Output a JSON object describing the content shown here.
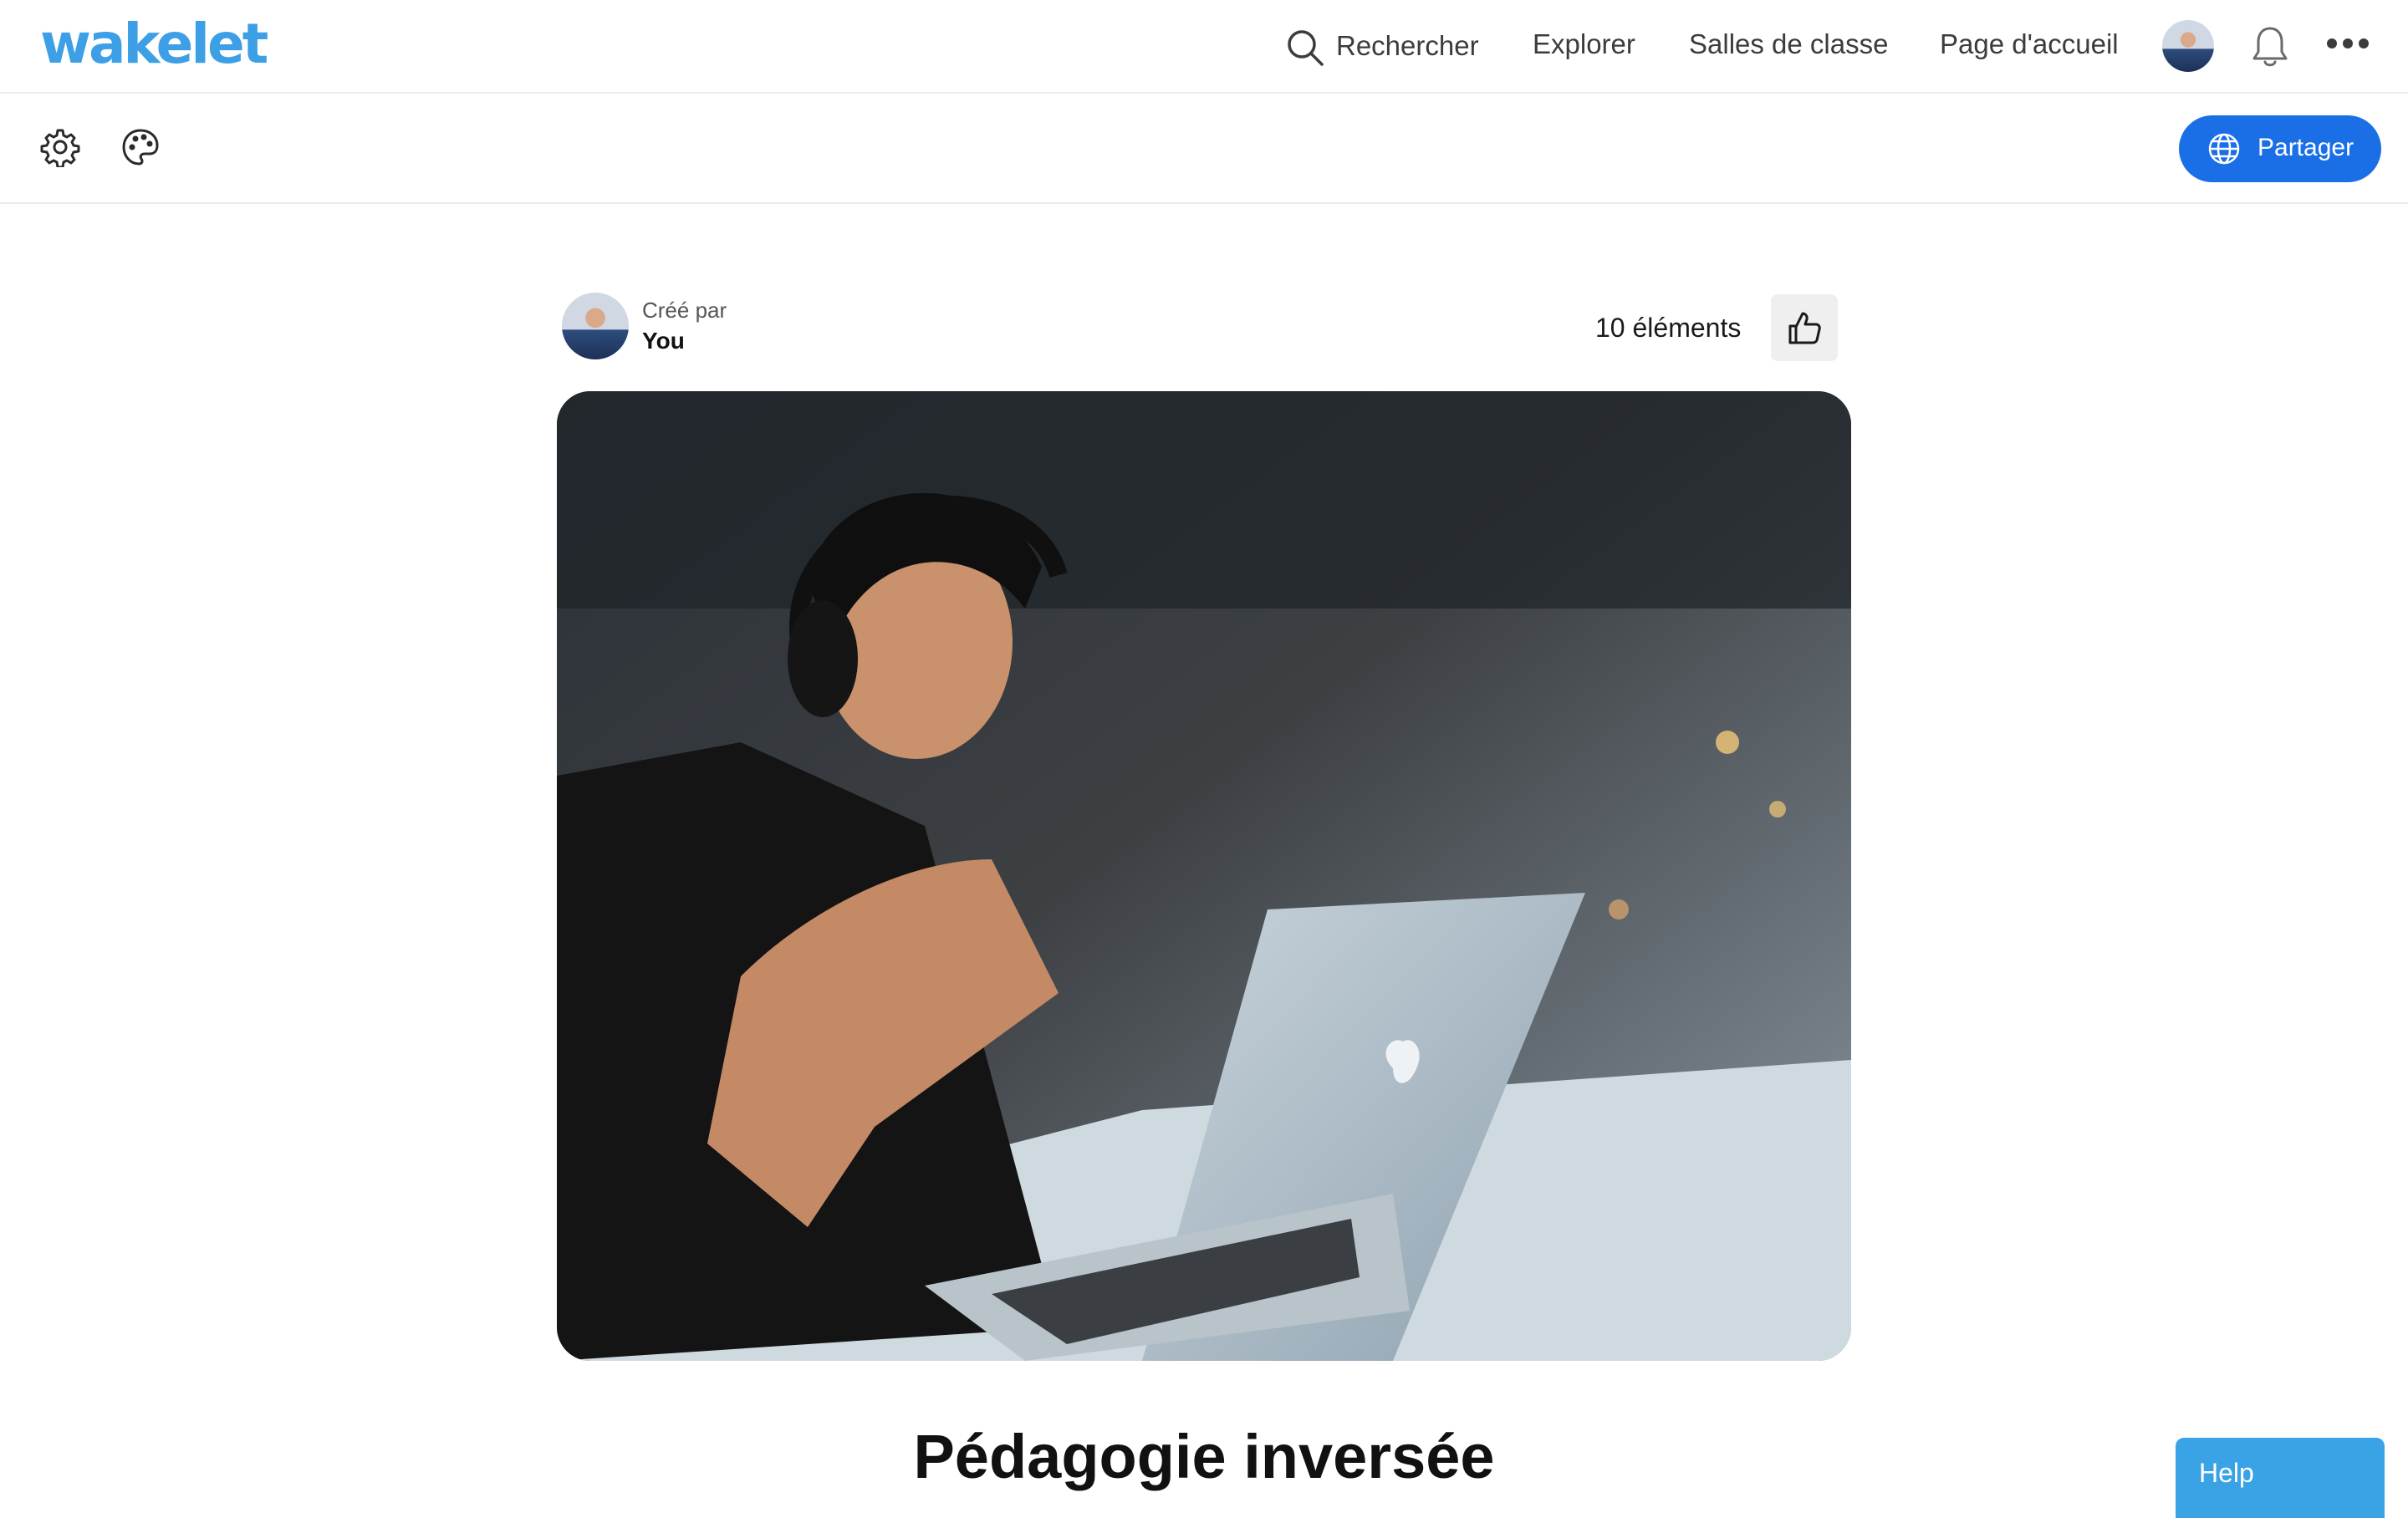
{
  "brand": {
    "logo_text": "wakelet"
  },
  "header": {
    "search_label": "Rechercher",
    "nav": [
      "Explorer",
      "Salles de classe",
      "Page d'accueil"
    ]
  },
  "toolbar": {
    "share_label": "Partager"
  },
  "collection": {
    "created_by_label": "Créé par",
    "creator_name": "You",
    "item_count": "10 éléments",
    "title": "Pédagogie inversée"
  },
  "help": {
    "label": "Help"
  },
  "colors": {
    "brand": "#3d9fe6",
    "share_button": "#1a6fe6",
    "help_button": "#3aa3e6"
  }
}
